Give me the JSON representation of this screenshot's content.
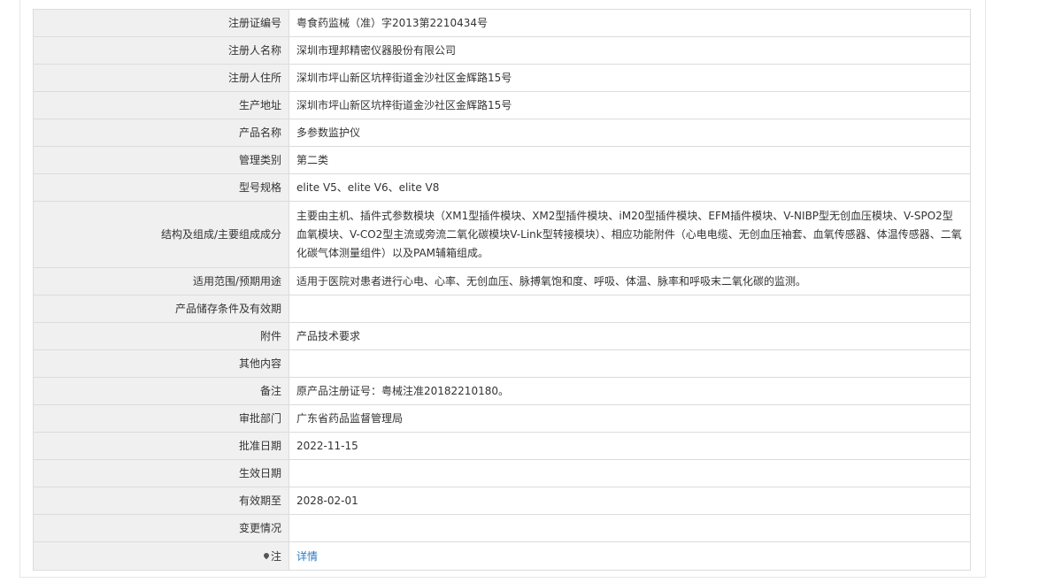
{
  "rows": [
    {
      "label": "注册证编号",
      "value": "粤食药监械（准）字2013第2210434号"
    },
    {
      "label": "注册人名称",
      "value": "深圳市理邦精密仪器股份有限公司"
    },
    {
      "label": "注册人住所",
      "value": "深圳市坪山新区坑梓街道金沙社区金辉路15号"
    },
    {
      "label": "生产地址",
      "value": "深圳市坪山新区坑梓街道金沙社区金辉路15号"
    },
    {
      "label": "产品名称",
      "value": "多参数监护仪"
    },
    {
      "label": "管理类别",
      "value": "第二类"
    },
    {
      "label": "型号规格",
      "value": "elite V5、elite V6、elite V8"
    },
    {
      "label": "结构及组成/主要组成成分",
      "value": "主要由主机、插件式参数模块（XM1型插件模块、XM2型插件模块、iM20型插件模块、EFM插件模块、V-NIBP型无创血压模块、V-SPO2型血氧模块、V-CO2型主流或旁流二氧化碳模块V-Link型转接模块）、相应功能附件（心电电缆、无创血压袖套、血氧传感器、体温传感器、二氧化碳气体测量组件）以及PAM辅箱组成。"
    },
    {
      "label": "适用范围/预期用途",
      "value": "适用于医院对患者进行心电、心率、无创血压、脉搏氧饱和度、呼吸、体温、脉率和呼吸末二氧化碳的监测。"
    },
    {
      "label": "产品储存条件及有效期",
      "value": ""
    },
    {
      "label": "附件",
      "value": "产品技术要求"
    },
    {
      "label": "其他内容",
      "value": ""
    },
    {
      "label": "备注",
      "value": "原产品注册证号：粤械注准20182210180。"
    },
    {
      "label": "审批部门",
      "value": "广东省药品监督管理局"
    },
    {
      "label": "批准日期",
      "value": "2022-11-15"
    },
    {
      "label": "生效日期",
      "value": ""
    },
    {
      "label": "有效期至",
      "value": "2028-02-01"
    },
    {
      "label": "变更情况",
      "value": ""
    }
  ],
  "note_row": {
    "label": "注",
    "icon": "pin-icon",
    "link_label": "详情"
  }
}
